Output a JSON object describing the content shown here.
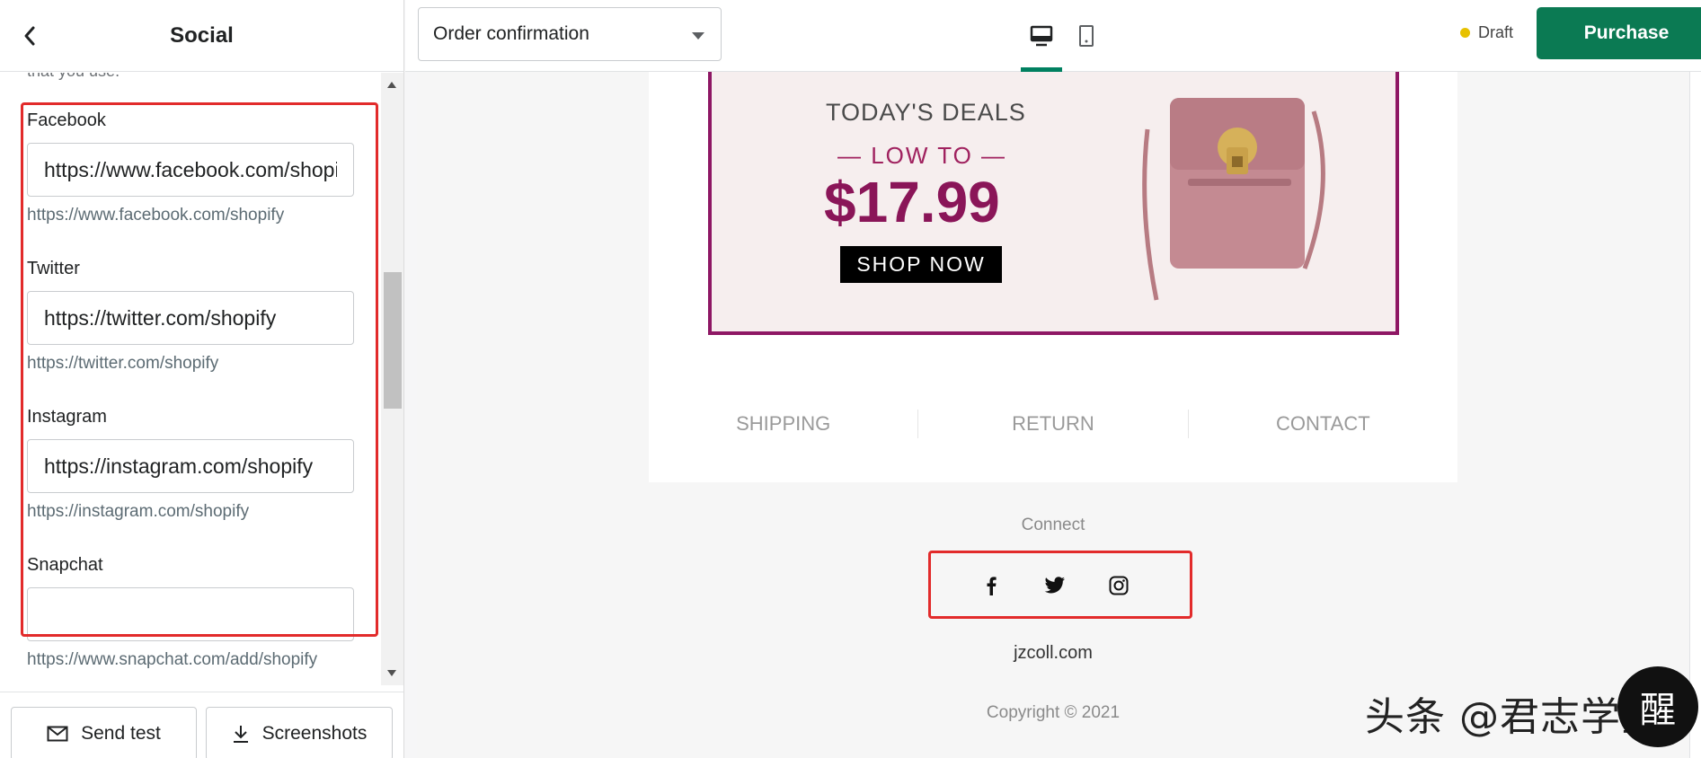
{
  "sidebar": {
    "title": "Social",
    "back_icon": "chevron-left-icon",
    "cut_text": "that you use.",
    "fields": [
      {
        "label": "Facebook",
        "value": "https://www.facebook.com/shopify",
        "help": "https://www.facebook.com/shopify"
      },
      {
        "label": "Twitter",
        "value": "https://twitter.com/shopify",
        "help": "https://twitter.com/shopify"
      },
      {
        "label": "Instagram",
        "value": "https://instagram.com/shopify",
        "help": "https://instagram.com/shopify"
      },
      {
        "label": "Snapchat",
        "value": "",
        "help": "https://www.snapchat.com/add/shopify"
      }
    ],
    "footer": {
      "send_test": "Send test",
      "screenshots": "Screenshots"
    }
  },
  "topbar": {
    "template_select": "Order confirmation",
    "views": [
      "desktop-icon",
      "mobile-icon"
    ],
    "status": "Draft",
    "status_color": "#e7c100",
    "purchase": "Purchase",
    "accent": "#0b7a53"
  },
  "preview": {
    "banner": {
      "title": "TODAY'S DEALS",
      "subtitle": "— LOW TO —",
      "price": "$17.99",
      "cta": "SHOP NOW",
      "border_color": "#8e1764"
    },
    "nav": [
      "SHIPPING",
      "RETURN",
      "CONTACT"
    ],
    "connect": "Connect",
    "social_icons": [
      "facebook-icon",
      "twitter-icon",
      "instagram-icon"
    ],
    "site": "jzcoll.com",
    "copyright": "Copyright © 2021"
  },
  "watermark": {
    "text": "头条 @君志学堂",
    "logo": "醒"
  }
}
